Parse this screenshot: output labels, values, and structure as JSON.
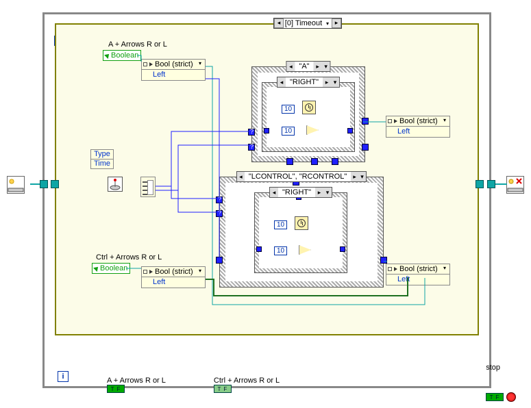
{
  "loop_const": "10",
  "i_label": "i",
  "event_case": "[0] Timeout",
  "labels": {
    "a_arrows": "A + Arrows R or L",
    "ctrl_arrows": "Ctrl + Arrows R or L",
    "boolean": "Boolean",
    "stop": "stop"
  },
  "prop": {
    "head": "Bool (strict)",
    "body": "Left"
  },
  "type_time": {
    "type": "Type",
    "time": "Time"
  },
  "case_upper_outer": "\"A\"",
  "case_upper_inner": "\"RIGHT\"",
  "case_lower_outer": "\"LCONTROL\", \"RCONTROL\"",
  "case_lower_inner": "\"RIGHT\"",
  "ten": "10",
  "tf": "T F"
}
